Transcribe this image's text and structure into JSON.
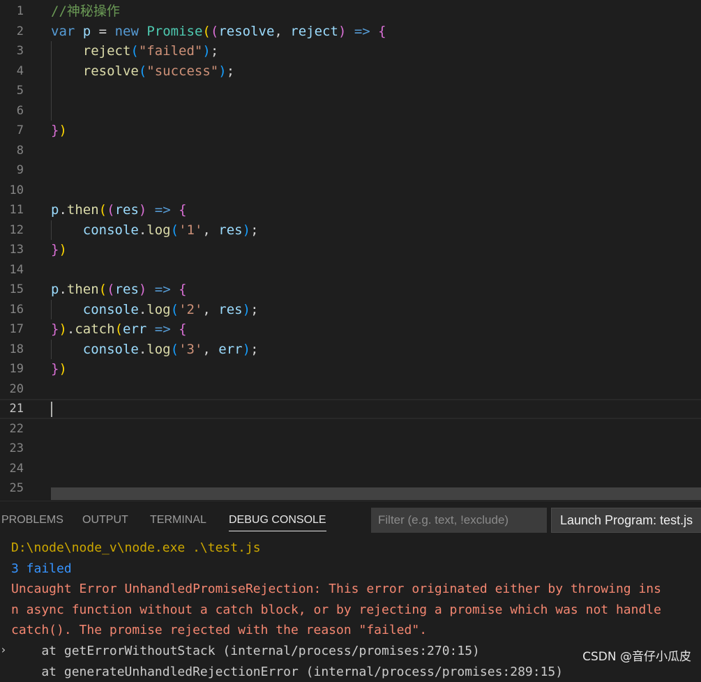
{
  "colors": {
    "keyword": "#569cd6",
    "identifier": "#9cdcfe",
    "plain": "#d4d4d4",
    "string": "#ce9178",
    "comment": "#6a9955",
    "class_name": "#4ec9b0",
    "function": "#dcdcaa",
    "bracket_gold": "#ffd700",
    "bracket_pink": "#da70d6",
    "bracket_blue": "#179fff",
    "path": "#cca700",
    "info": "#3794ff",
    "error": "#f48771",
    "stack": "#cccccc"
  },
  "editor": {
    "lines": [
      {
        "num": "1",
        "tokens": [
          {
            "t": "//神秘操作",
            "c": "comment"
          }
        ]
      },
      {
        "num": "2",
        "tokens": [
          {
            "t": "var",
            "c": "keyword"
          },
          {
            "t": " ",
            "c": "plain"
          },
          {
            "t": "p",
            "c": "identifier"
          },
          {
            "t": " = ",
            "c": "plain"
          },
          {
            "t": "new",
            "c": "keyword"
          },
          {
            "t": " ",
            "c": "plain"
          },
          {
            "t": "Promise",
            "c": "class_name"
          },
          {
            "t": "(",
            "c": "bracket_gold"
          },
          {
            "t": "(",
            "c": "bracket_pink"
          },
          {
            "t": "resolve",
            "c": "identifier"
          },
          {
            "t": ", ",
            "c": "plain"
          },
          {
            "t": "reject",
            "c": "identifier"
          },
          {
            "t": ")",
            "c": "bracket_pink"
          },
          {
            "t": " => ",
            "c": "keyword"
          },
          {
            "t": "{",
            "c": "bracket_pink"
          }
        ]
      },
      {
        "num": "3",
        "tokens": [
          {
            "t": "    ",
            "c": "plain"
          },
          {
            "t": "reject",
            "c": "function"
          },
          {
            "t": "(",
            "c": "bracket_blue"
          },
          {
            "t": "\"failed\"",
            "c": "string"
          },
          {
            "t": ")",
            "c": "bracket_blue"
          },
          {
            "t": ";",
            "c": "plain"
          }
        ]
      },
      {
        "num": "4",
        "tokens": [
          {
            "t": "    ",
            "c": "plain"
          },
          {
            "t": "resolve",
            "c": "function"
          },
          {
            "t": "(",
            "c": "bracket_blue"
          },
          {
            "t": "\"success\"",
            "c": "string"
          },
          {
            "t": ")",
            "c": "bracket_blue"
          },
          {
            "t": ";",
            "c": "plain"
          }
        ]
      },
      {
        "num": "5",
        "tokens": []
      },
      {
        "num": "6",
        "tokens": []
      },
      {
        "num": "7",
        "tokens": [
          {
            "t": "}",
            "c": "bracket_pink"
          },
          {
            "t": ")",
            "c": "bracket_gold"
          }
        ]
      },
      {
        "num": "8",
        "tokens": []
      },
      {
        "num": "9",
        "tokens": []
      },
      {
        "num": "10",
        "tokens": []
      },
      {
        "num": "11",
        "tokens": [
          {
            "t": "p",
            "c": "identifier"
          },
          {
            "t": ".",
            "c": "plain"
          },
          {
            "t": "then",
            "c": "function"
          },
          {
            "t": "(",
            "c": "bracket_gold"
          },
          {
            "t": "(",
            "c": "bracket_pink"
          },
          {
            "t": "res",
            "c": "identifier"
          },
          {
            "t": ")",
            "c": "bracket_pink"
          },
          {
            "t": " => ",
            "c": "keyword"
          },
          {
            "t": "{",
            "c": "bracket_pink"
          }
        ]
      },
      {
        "num": "12",
        "tokens": [
          {
            "t": "    ",
            "c": "plain"
          },
          {
            "t": "console",
            "c": "identifier"
          },
          {
            "t": ".",
            "c": "plain"
          },
          {
            "t": "log",
            "c": "function"
          },
          {
            "t": "(",
            "c": "bracket_blue"
          },
          {
            "t": "'1'",
            "c": "string"
          },
          {
            "t": ", ",
            "c": "plain"
          },
          {
            "t": "res",
            "c": "identifier"
          },
          {
            "t": ")",
            "c": "bracket_blue"
          },
          {
            "t": ";",
            "c": "plain"
          }
        ]
      },
      {
        "num": "13",
        "tokens": [
          {
            "t": "}",
            "c": "bracket_pink"
          },
          {
            "t": ")",
            "c": "bracket_gold"
          }
        ]
      },
      {
        "num": "14",
        "tokens": []
      },
      {
        "num": "15",
        "tokens": [
          {
            "t": "p",
            "c": "identifier"
          },
          {
            "t": ".",
            "c": "plain"
          },
          {
            "t": "then",
            "c": "function"
          },
          {
            "t": "(",
            "c": "bracket_gold"
          },
          {
            "t": "(",
            "c": "bracket_pink"
          },
          {
            "t": "res",
            "c": "identifier"
          },
          {
            "t": ")",
            "c": "bracket_pink"
          },
          {
            "t": " => ",
            "c": "keyword"
          },
          {
            "t": "{",
            "c": "bracket_pink"
          }
        ]
      },
      {
        "num": "16",
        "tokens": [
          {
            "t": "    ",
            "c": "plain"
          },
          {
            "t": "console",
            "c": "identifier"
          },
          {
            "t": ".",
            "c": "plain"
          },
          {
            "t": "log",
            "c": "function"
          },
          {
            "t": "(",
            "c": "bracket_blue"
          },
          {
            "t": "'2'",
            "c": "string"
          },
          {
            "t": ", ",
            "c": "plain"
          },
          {
            "t": "res",
            "c": "identifier"
          },
          {
            "t": ")",
            "c": "bracket_blue"
          },
          {
            "t": ";",
            "c": "plain"
          }
        ]
      },
      {
        "num": "17",
        "tokens": [
          {
            "t": "}",
            "c": "bracket_pink"
          },
          {
            "t": ")",
            "c": "bracket_gold"
          },
          {
            "t": ".",
            "c": "plain"
          },
          {
            "t": "catch",
            "c": "function"
          },
          {
            "t": "(",
            "c": "bracket_gold"
          },
          {
            "t": "err",
            "c": "identifier"
          },
          {
            "t": " => ",
            "c": "keyword"
          },
          {
            "t": "{",
            "c": "bracket_pink"
          }
        ]
      },
      {
        "num": "18",
        "tokens": [
          {
            "t": "    ",
            "c": "plain"
          },
          {
            "t": "console",
            "c": "identifier"
          },
          {
            "t": ".",
            "c": "plain"
          },
          {
            "t": "log",
            "c": "function"
          },
          {
            "t": "(",
            "c": "bracket_blue"
          },
          {
            "t": "'3'",
            "c": "string"
          },
          {
            "t": ", ",
            "c": "plain"
          },
          {
            "t": "err",
            "c": "identifier"
          },
          {
            "t": ")",
            "c": "bracket_blue"
          },
          {
            "t": ";",
            "c": "plain"
          }
        ]
      },
      {
        "num": "19",
        "tokens": [
          {
            "t": "}",
            "c": "bracket_pink"
          },
          {
            "t": ")",
            "c": "bracket_gold"
          }
        ]
      },
      {
        "num": "20",
        "tokens": []
      },
      {
        "num": "21",
        "tokens": []
      },
      {
        "num": "22",
        "tokens": []
      },
      {
        "num": "23",
        "tokens": []
      },
      {
        "num": "24",
        "tokens": []
      },
      {
        "num": "25",
        "tokens": []
      }
    ]
  },
  "panel": {
    "tabs": {
      "problems": "PROBLEMS",
      "output": "OUTPUT",
      "terminal": "TERMINAL",
      "debug_console": "DEBUG CONSOLE"
    },
    "filter_placeholder": "Filter (e.g. text, !exclude)",
    "launch_config": "Launch Program: test.js",
    "output_lines": [
      {
        "text": "D:\\node\\node_v\\node.exe .\\test.js",
        "c": "path"
      },
      {
        "text": "3 failed",
        "c": "info"
      },
      {
        "text": "Uncaught Error UnhandledPromiseRejection: This error originated either by throwing ins",
        "c": "error"
      },
      {
        "text": "n async function without a catch block, or by rejecting a promise which was not handle",
        "c": "error"
      },
      {
        "text": "catch(). The promise rejected with the reason \"failed\".",
        "c": "error"
      },
      {
        "text": "    at getErrorWithoutStack (internal/process/promises:270:15)",
        "c": "stack"
      },
      {
        "text": "    at generateUnhandledRejectionError (internal/process/promises:289:15)",
        "c": "stack"
      }
    ],
    "expand_icon": "chevron-right-icon"
  },
  "watermark": "CSDN @音仔小瓜皮"
}
